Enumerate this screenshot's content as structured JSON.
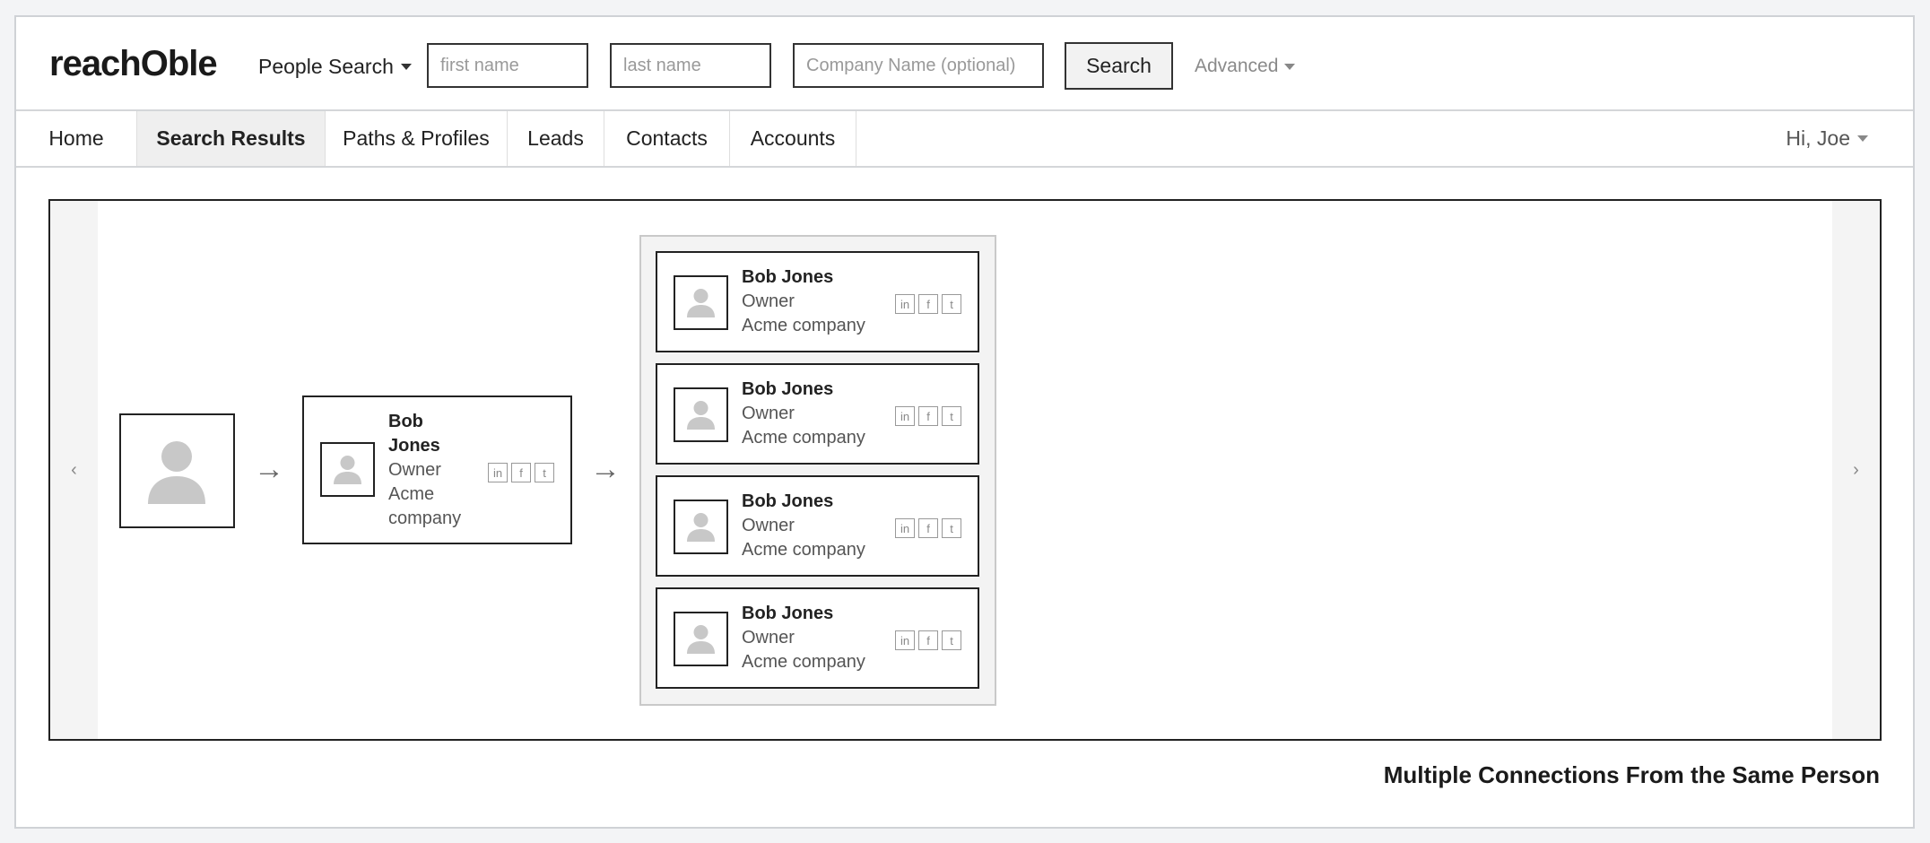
{
  "header": {
    "logo": "reachOble",
    "search_mode": "People Search",
    "first_name_placeholder": "first name",
    "last_name_placeholder": "last name",
    "company_placeholder": "Company Name (optional)",
    "search_label": "Search",
    "advanced_label": "Advanced"
  },
  "nav": {
    "tabs": [
      {
        "label": "Home"
      },
      {
        "label": "Search Results"
      },
      {
        "label": "Paths & Profiles"
      },
      {
        "label": "Leads"
      },
      {
        "label": "Contacts"
      },
      {
        "label": "Accounts"
      }
    ],
    "active_tab": "Search Results",
    "greeting": "Hi, Joe"
  },
  "carousel": {
    "prev": "‹",
    "next": "›",
    "arrow": "→",
    "first_connection": {
      "name_line1": "Bob",
      "name_line2": "Jones",
      "title": "Owner",
      "company_line1": "Acme",
      "company_line2": "company",
      "socials": [
        "in",
        "f",
        "t"
      ]
    },
    "connections": [
      {
        "name": "Bob Jones",
        "title": "Owner",
        "company": "Acme company",
        "socials": [
          "in",
          "f",
          "t"
        ]
      },
      {
        "name": "Bob Jones",
        "title": "Owner",
        "company": "Acme company",
        "socials": [
          "in",
          "f",
          "t"
        ]
      },
      {
        "name": "Bob Jones",
        "title": "Owner",
        "company": "Acme company",
        "socials": [
          "in",
          "f",
          "t"
        ]
      },
      {
        "name": "Bob Jones",
        "title": "Owner",
        "company": "Acme company",
        "socials": [
          "in",
          "f",
          "t"
        ]
      }
    ]
  },
  "caption": "Multiple Connections From the Same Person"
}
